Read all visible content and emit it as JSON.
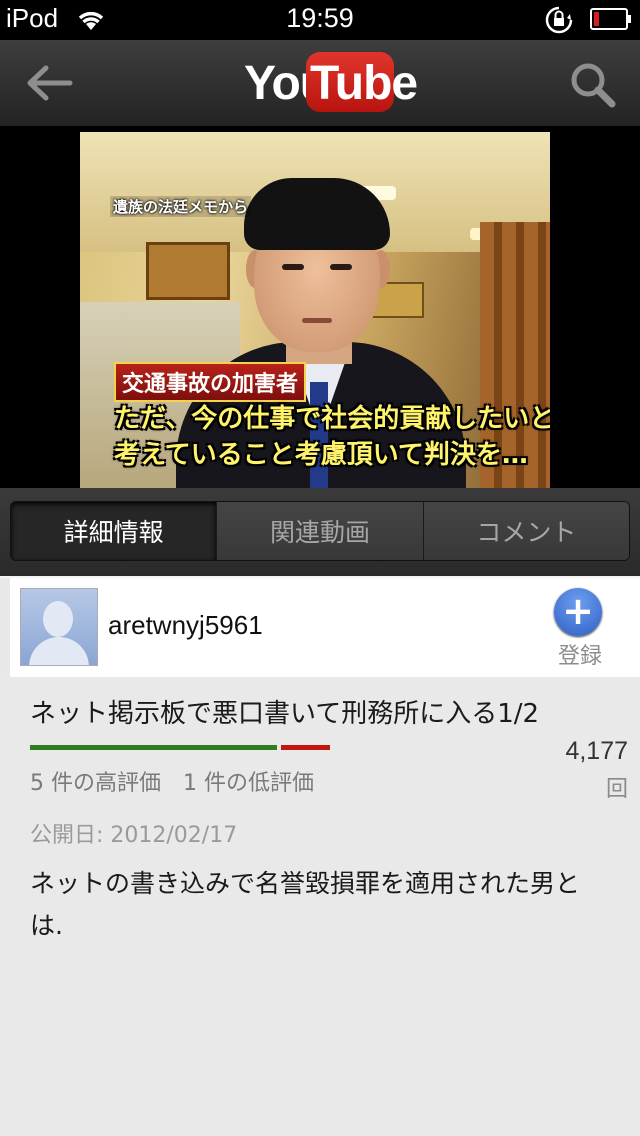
{
  "status_bar": {
    "carrier": "iPod",
    "time": "19:59",
    "wifi_icon": "wifi-icon",
    "lock_icon": "rotation-lock-icon",
    "battery_icon": "battery-low-icon",
    "battery_color": "#d42020"
  },
  "nav": {
    "back_icon": "back-arrow-icon",
    "logo_you": "You",
    "logo_tube": "Tube",
    "search_icon": "search-icon",
    "brand_red": "#cc1f17"
  },
  "video": {
    "caption_top": "遺族の法廷メモから",
    "label": "交通事故の加害者",
    "subtitle_line1": "ただ、今の仕事で社会的貢献したいと",
    "subtitle_line2": "考えていること考慮頂いて判決を…"
  },
  "tabs": [
    {
      "label": "詳細情報",
      "active": true
    },
    {
      "label": "関連動画",
      "active": false
    },
    {
      "label": "コメント",
      "active": false
    }
  ],
  "channel": {
    "name": "aretwnyj5961",
    "subscribe_icon": "plus-icon",
    "subscribe_label": "登録"
  },
  "details": {
    "title": "ネット掲示板で悪口書いて刑務所に入る1/2",
    "likes": 5,
    "dislikes": 1,
    "ratings_text": "5 件の高評価　1 件の低評価",
    "view_count": "4,177",
    "view_unit": "回",
    "published": "公開日: 2012/02/17",
    "description": "ネットの書き込みで名誉毀損罪を適用された男とは."
  }
}
